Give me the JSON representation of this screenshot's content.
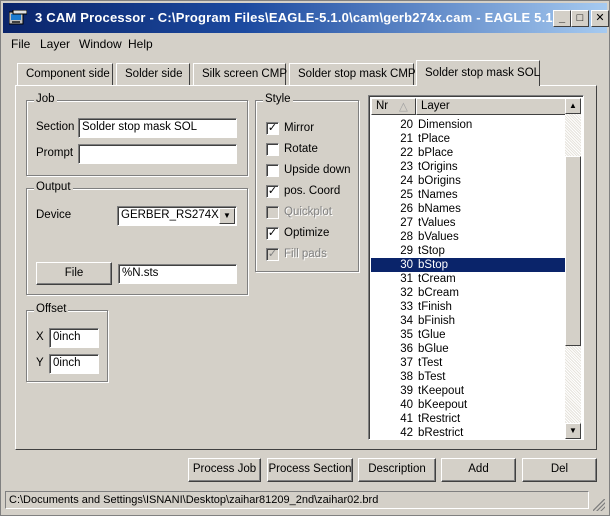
{
  "window": {
    "title": "3 CAM Processor - C:\\Program Files\\EAGLE-5.1.0\\cam\\gerb274x.cam - EAGLE 5.1...",
    "minimize": "_",
    "maximize": "□",
    "close": "✕",
    "icon": "cam-processor-icon"
  },
  "menu": [
    "File",
    "Layer",
    "Window",
    "Help"
  ],
  "tabs": [
    {
      "label": "Component side"
    },
    {
      "label": "Solder side"
    },
    {
      "label": "Silk screen CMP"
    },
    {
      "label": "Solder stop mask CMP"
    },
    {
      "label": "Solder stop mask SOL",
      "active": true
    }
  ],
  "job": {
    "group_label": "Job",
    "section_label": "Section",
    "section_value": "Solder stop mask SOL",
    "prompt_label": "Prompt",
    "prompt_value": ""
  },
  "output": {
    "group_label": "Output",
    "device_label": "Device",
    "device_value": "GERBER_RS274X",
    "file_button": "File",
    "file_value": "%N.sts"
  },
  "offset": {
    "group_label": "Offset",
    "x_label": "X",
    "x_value": "0inch",
    "y_label": "Y",
    "y_value": "0inch"
  },
  "style": {
    "group_label": "Style",
    "options": [
      {
        "label": "Mirror",
        "checked": true,
        "enabled": true
      },
      {
        "label": "Rotate",
        "checked": false,
        "enabled": true
      },
      {
        "label": "Upside down",
        "checked": false,
        "enabled": true
      },
      {
        "label": "pos. Coord",
        "checked": true,
        "enabled": true
      },
      {
        "label": "Quickplot",
        "checked": false,
        "enabled": false
      },
      {
        "label": "Optimize",
        "checked": true,
        "enabled": true
      },
      {
        "label": "Fill pads",
        "checked": true,
        "enabled": false
      }
    ]
  },
  "layers": {
    "col_nr": "Nr",
    "col_layer": "Layer",
    "selected_nr": "30",
    "rows": [
      {
        "nr": "20",
        "name": "Dimension"
      },
      {
        "nr": "21",
        "name": "tPlace"
      },
      {
        "nr": "22",
        "name": "bPlace"
      },
      {
        "nr": "23",
        "name": "tOrigins"
      },
      {
        "nr": "24",
        "name": "bOrigins"
      },
      {
        "nr": "25",
        "name": "tNames"
      },
      {
        "nr": "26",
        "name": "bNames"
      },
      {
        "nr": "27",
        "name": "tValues"
      },
      {
        "nr": "28",
        "name": "bValues"
      },
      {
        "nr": "29",
        "name": "tStop"
      },
      {
        "nr": "30",
        "name": "bStop"
      },
      {
        "nr": "31",
        "name": "tCream"
      },
      {
        "nr": "32",
        "name": "bCream"
      },
      {
        "nr": "33",
        "name": "tFinish"
      },
      {
        "nr": "34",
        "name": "bFinish"
      },
      {
        "nr": "35",
        "name": "tGlue"
      },
      {
        "nr": "36",
        "name": "bGlue"
      },
      {
        "nr": "37",
        "name": "tTest"
      },
      {
        "nr": "38",
        "name": "bTest"
      },
      {
        "nr": "39",
        "name": "tKeepout"
      },
      {
        "nr": "40",
        "name": "bKeepout"
      },
      {
        "nr": "41",
        "name": "tRestrict"
      },
      {
        "nr": "42",
        "name": "bRestrict"
      }
    ]
  },
  "buttons": {
    "process_job": "Process Job",
    "process_section": "Process Section",
    "description": "Description",
    "add": "Add",
    "del": "Del"
  },
  "status": "C:\\Documents and Settings\\ISNANI\\Desktop\\zaihar81209_2nd\\zaihar02.brd",
  "colors": {
    "selection": "#0a246a",
    "titlebar_start": "#0a246a",
    "titlebar_end": "#a6caf0",
    "face": "#d4d0c8"
  }
}
